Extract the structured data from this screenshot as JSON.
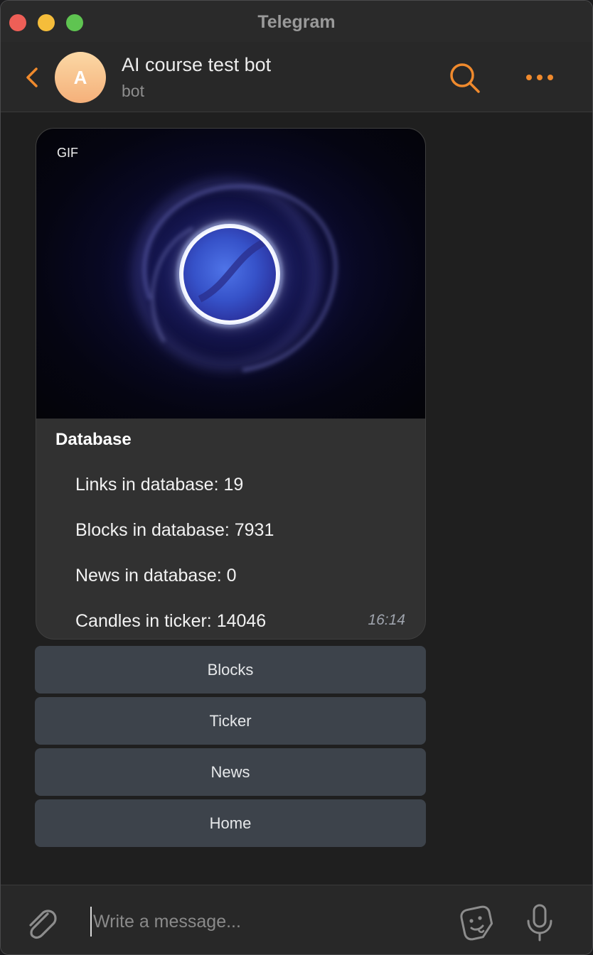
{
  "window": {
    "title": "Telegram"
  },
  "header": {
    "avatar_letter": "A",
    "chat_name": "AI course test bot",
    "chat_subtitle": "bot",
    "icons": {
      "back": "chevron-left-icon",
      "search": "search-icon",
      "more": "more-dots-icon"
    }
  },
  "message": {
    "media_label": "GIF",
    "title": "Database",
    "lines": [
      "Links in database: 19",
      "Blocks in database: 7931",
      "News in database: 0",
      "Candles in ticker: 14046"
    ],
    "time": "16:14"
  },
  "keyboard": {
    "buttons": [
      "Blocks",
      "Ticker",
      "News",
      "Home"
    ]
  },
  "composer": {
    "placeholder": "Write a message...",
    "value": "",
    "icons": {
      "attach": "paperclip-icon",
      "sticker": "sticker-icon",
      "mic": "microphone-icon"
    }
  },
  "colors": {
    "accent": "#f08a2d",
    "background": "#1f1f1f",
    "bubble": "#313131",
    "keyboard_button": "#3d434b"
  }
}
